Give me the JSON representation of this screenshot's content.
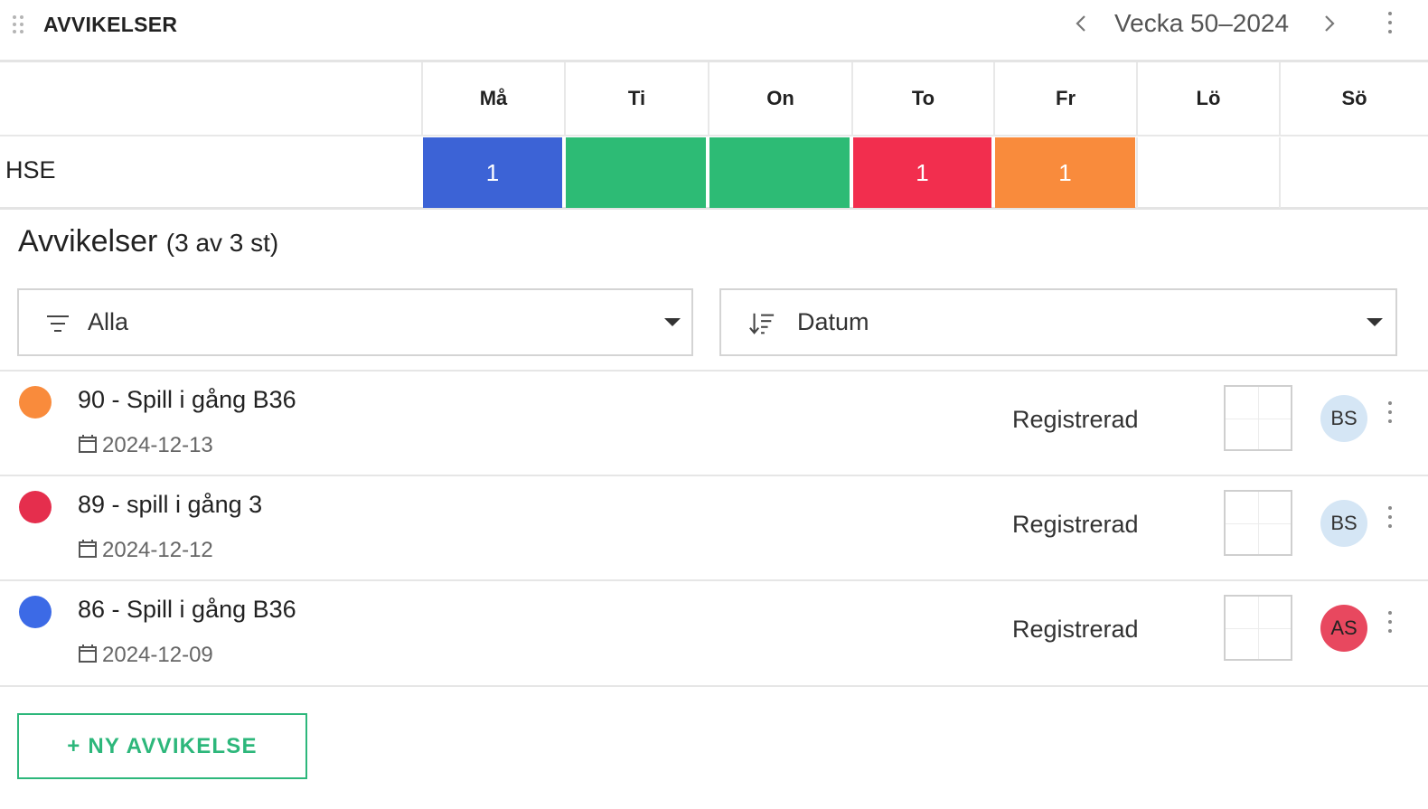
{
  "header": {
    "title": "AVVIKELSER",
    "week_label": "Vecka 50–2024"
  },
  "calendar": {
    "days": [
      "Må",
      "Ti",
      "On",
      "To",
      "Fr",
      "Lö",
      "Sö"
    ],
    "row_label": "HSE",
    "cells": [
      {
        "day": "Må",
        "count": "1",
        "color": "#3c63d6"
      },
      {
        "day": "Ti",
        "count": "",
        "color": "#2dbb75"
      },
      {
        "day": "On",
        "count": "",
        "color": "#2dbb75"
      },
      {
        "day": "To",
        "count": "1",
        "color": "#f22e4e"
      },
      {
        "day": "Fr",
        "count": "1",
        "color": "#f98b3c"
      },
      {
        "day": "Lö",
        "count": "",
        "color": ""
      },
      {
        "day": "Sö",
        "count": "",
        "color": ""
      }
    ]
  },
  "list": {
    "title": "Avvikelser",
    "count": "(3 av 3 st)",
    "filter_value": "Alla",
    "sort_value": "Datum",
    "items": [
      {
        "title": "90 - Spill i gång B36",
        "date": "2024-12-13",
        "status": "Registrerad",
        "avatar": "BS",
        "dot_color": "#f98b3c",
        "avatar_color": "#d5e6f5"
      },
      {
        "title": "89 - spill i gång 3",
        "date": "2024-12-12",
        "status": "Registrerad",
        "avatar": "BS",
        "dot_color": "#e52e4d",
        "avatar_color": "#d5e6f5"
      },
      {
        "title": "86 - Spill i gång B36",
        "date": "2024-12-09",
        "status": "Registrerad",
        "avatar": "AS",
        "dot_color": "#3c6ae6",
        "avatar_color": "#e8485f"
      }
    ]
  },
  "actions": {
    "new_label": "+ NY AVVIKELSE"
  },
  "colors": {
    "accent_green": "#2db77b"
  }
}
